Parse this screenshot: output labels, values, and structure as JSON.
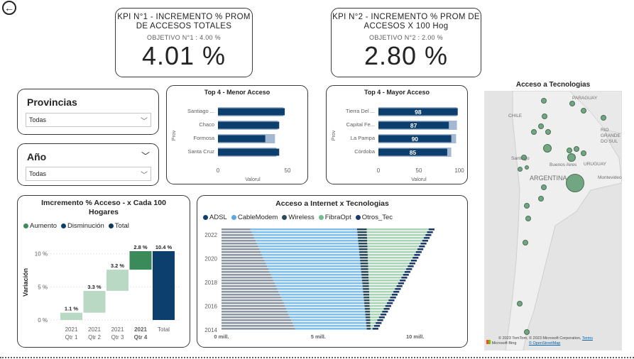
{
  "back_button": "←",
  "kpi1": {
    "title_line1": "KPI N°1 - INCREMENTO % PROM",
    "title_line2": "DE ACCESOS TOTALES",
    "objective": "OBJETIVO N°1 : 4.00 %",
    "value": "4.01 %"
  },
  "kpi2": {
    "title_line1": "KPI N°2 - INCREMENTO % PROM DE",
    "title_line2": "ACCESOS X 100 Hog",
    "objective": "OBJETIVO N°2 : 2.00 %",
    "value": "2.80 %"
  },
  "slicer_provincias": {
    "title": "Provincias",
    "value": "Todas"
  },
  "slicer_anio": {
    "title": "Año",
    "value": "Todas"
  },
  "colors": {
    "dark_blue": "#0c3f6e",
    "light_blue": "#a4b8d2",
    "green": "#3b8a5a",
    "light_green": "#bad9c4",
    "bubble": "#5d9a6f"
  },
  "chart_data": [
    {
      "id": "top4_menor",
      "type": "bar",
      "title": "Top 4 - Menor Acceso",
      "ylabel": "Prov",
      "xlabel": "Valorul",
      "categories": [
        "Santiago ...",
        "Chaco",
        "Formosa",
        "Santa Cruz"
      ],
      "series": [
        {
          "values": [
            48,
            44,
            34,
            44
          ]
        },
        {
          "values": [
            47,
            43,
            41,
            42
          ]
        }
      ],
      "xticks": [
        "0",
        "50"
      ],
      "xlim": [
        0,
        50
      ]
    },
    {
      "id": "top4_mayor",
      "type": "bar",
      "title": "Top 4 - Mayor Acceso",
      "ylabel": "Prov",
      "xlabel": "Valorul",
      "categories": [
        "Tierra Del ...",
        "Capital Fe...",
        "La Pampa",
        "Córdoba"
      ],
      "series": [
        {
          "values": [
            98,
            87,
            90,
            85
          ]
        },
        {
          "values": [
            97,
            97,
            96,
            90
          ]
        }
      ],
      "data_labels": [
        "98",
        "87",
        "90",
        "85"
      ],
      "xticks": [
        "0",
        "50",
        "100"
      ],
      "xlim": [
        0,
        100
      ]
    },
    {
      "id": "waterfall",
      "type": "bar",
      "title_line1": "Imcremento % Acceso - x Cada 100",
      "title_line2": "Hogares",
      "ylabel": "Variación",
      "legend": [
        "Aumento",
        "Disminución",
        "Total"
      ],
      "categories": [
        [
          "2021",
          "Qtr 1"
        ],
        [
          "2021",
          "Qtr 2"
        ],
        [
          "2021",
          "Qtr 3"
        ],
        [
          "2021",
          "Qtr 4"
        ],
        [
          "Total",
          ""
        ]
      ],
      "values": [
        1.1,
        3.3,
        3.2,
        2.8,
        10.4
      ],
      "data_labels": [
        "1.1 %",
        "3.3 %",
        "3.2 %",
        "2.8 %",
        "10.4 %"
      ],
      "yticks": [
        "0 %",
        "5 %",
        "10 %"
      ],
      "ylim": [
        0,
        10.4
      ]
    },
    {
      "id": "tecnologias",
      "type": "bar",
      "title": "Acceso a Internet x Tecnologias",
      "legend": [
        "ADSL",
        "CableModem",
        "Wireless",
        "FibraOpt",
        "Otros_Tec"
      ],
      "legend_colors": [
        "#0c3f6e",
        "#5ba6e6",
        "#2b4a5c",
        "#6fbd8c",
        "#1c3a6e"
      ],
      "yticks": [
        "2022",
        "2020",
        "2018",
        "2016",
        "2014"
      ],
      "xticks": [
        "0 mill.",
        "5 mill.",
        "10 mill."
      ],
      "xlim": [
        0,
        11
      ]
    }
  ],
  "map": {
    "title": "Acceso a Tecnologias",
    "labels": [
      "PARAGUAY",
      "CHILE",
      "ARGENTINA",
      "URUGUAY",
      "Buenos Aires",
      "Santiago",
      "RIO GRANDE DO SUL",
      "Montevideo"
    ],
    "attribution": "© 2023 TomTom, © 2023 Microsoft Corporation,",
    "terms": "Terms",
    "osm": "© OpenStreetMap",
    "provider": "Microsoft Bing"
  }
}
